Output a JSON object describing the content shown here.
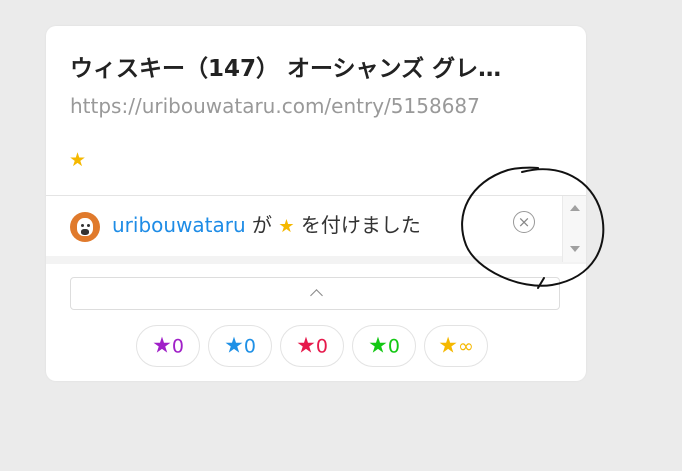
{
  "entry": {
    "title": "ウィスキー（147） オーシャンズ グレ…",
    "url": "https://uribouwataru.com/entry/5158687",
    "star_glyph": "★"
  },
  "star_list": {
    "username": "uribouwataru",
    "particle": "が",
    "star_glyph": "★",
    "action_text": "を付けました",
    "remove_glyph": "×"
  },
  "palette": [
    {
      "name": "purple",
      "glyph": "★",
      "count": "0",
      "color": "#a020c8"
    },
    {
      "name": "blue",
      "glyph": "★",
      "count": "0",
      "color": "#1e90e6"
    },
    {
      "name": "red",
      "glyph": "★",
      "count": "0",
      "color": "#e6194b"
    },
    {
      "name": "green",
      "glyph": "★",
      "count": "0",
      "color": "#13c813"
    },
    {
      "name": "yellow",
      "glyph": "★",
      "count": "∞",
      "color": "#f5b800"
    }
  ]
}
